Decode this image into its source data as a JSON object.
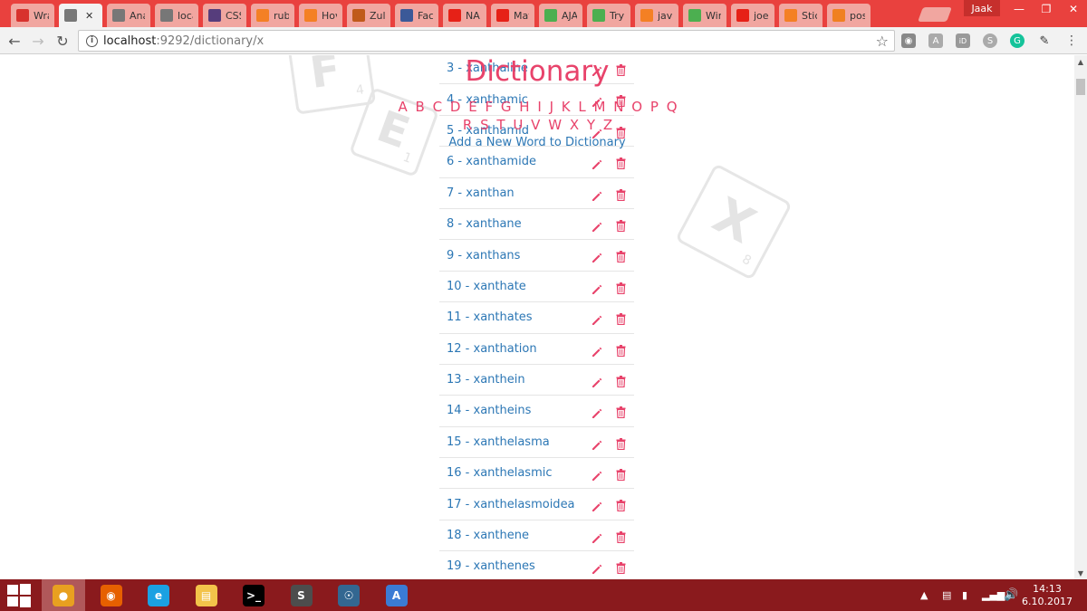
{
  "browser": {
    "tabs": [
      {
        "label": "Wra",
        "icon": "ruby-icon",
        "color": "#d8322e"
      },
      {
        "label": "́",
        "icon": "document-icon",
        "color": "#777777",
        "active": true
      },
      {
        "label": "Ana",
        "icon": "document-icon",
        "color": "#777777"
      },
      {
        "label": "loca",
        "icon": "document-icon",
        "color": "#777777"
      },
      {
        "label": "CSS",
        "icon": "bootstrap-icon",
        "color": "#563d7c"
      },
      {
        "label": "ruby",
        "icon": "stackoverflow-icon",
        "color": "#f48024"
      },
      {
        "label": "Hov",
        "icon": "stackoverflow-icon",
        "color": "#f48024"
      },
      {
        "label": "Zule",
        "icon": "app-icon",
        "color": "#c05a1a"
      },
      {
        "label": "Face",
        "icon": "facebook-icon",
        "color": "#3b5998"
      },
      {
        "label": "NA",
        "icon": "youtube-icon",
        "color": "#e62117"
      },
      {
        "label": "Mat",
        "icon": "youtube-icon",
        "color": "#e62117"
      },
      {
        "label": "AJA",
        "icon": "w3schools-icon",
        "color": "#4caf50"
      },
      {
        "label": "Tryi",
        "icon": "w3schools-icon",
        "color": "#4caf50"
      },
      {
        "label": "java",
        "icon": "stackoverflow-icon",
        "color": "#f48024"
      },
      {
        "label": "Win",
        "icon": "w3schools-icon",
        "color": "#4caf50"
      },
      {
        "label": "joe",
        "icon": "youtube-icon",
        "color": "#e62117"
      },
      {
        "label": "Stic",
        "icon": "stackoverflow-icon",
        "color": "#f48024"
      },
      {
        "label": "pos",
        "icon": "asterisk-icon",
        "color": "#f08020"
      }
    ],
    "user": "Jaak",
    "url_host": "localhost",
    "url_path": ":9292/dictionary/x"
  },
  "page": {
    "title": "Dictionary",
    "alphabet": [
      "A",
      "B",
      "C",
      "D",
      "E",
      "F",
      "G",
      "H",
      "I",
      "J",
      "K",
      "L",
      "M",
      "N",
      "O",
      "P",
      "Q",
      "R",
      "S",
      "T",
      "U",
      "V",
      "W",
      "X",
      "Y",
      "Z"
    ],
    "add_link": "Add a New Word to Dictionary",
    "words": [
      "3 - xanthaline",
      "4 - xanthamic",
      "5 - xanthamid",
      "6 - xanthamide",
      "7 - xanthan",
      "8 - xanthane",
      "9 - xanthans",
      "10 - xanthate",
      "11 - xanthates",
      "12 - xanthation",
      "13 - xanthein",
      "14 - xantheins",
      "15 - xanthelasma",
      "16 - xanthelasmic",
      "17 - xanthelasmoidea",
      "18 - xanthene",
      "19 - xanthenes"
    ],
    "tiles": [
      {
        "letter": "F",
        "score": "4"
      },
      {
        "letter": "E",
        "score": "1"
      },
      {
        "letter": "X",
        "score": "8"
      }
    ],
    "colors": {
      "accent": "#e8436b",
      "link": "#2c77b5"
    }
  },
  "taskbar": {
    "apps": [
      {
        "name": "chrome",
        "color": "#e8a020",
        "active": true
      },
      {
        "name": "firefox",
        "color": "#e66000"
      },
      {
        "name": "ie",
        "color": "#1ba1e2"
      },
      {
        "name": "explorer",
        "color": "#f3c34a"
      },
      {
        "name": "cmd",
        "color": "#000000"
      },
      {
        "name": "sublime",
        "color": "#4d4d4d"
      },
      {
        "name": "postgres",
        "color": "#336791"
      },
      {
        "name": "paint",
        "color": "#3b7bd4"
      }
    ],
    "time": "14:13",
    "date": "6.10.2017"
  }
}
